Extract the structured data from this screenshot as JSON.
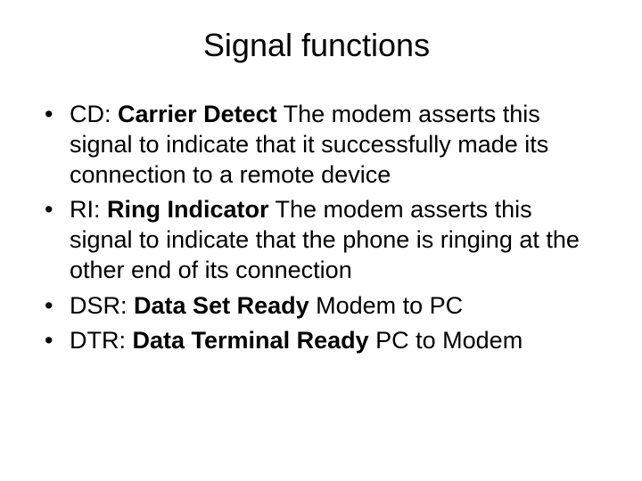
{
  "title": "Signal functions",
  "items": [
    {
      "acronym": "CD",
      "term": "Carrier Detect",
      "desc": " The modem asserts this signal to indicate that it successfully made its connection to a remote device"
    },
    {
      "acronym": "RI",
      "term": "Ring Indicator",
      "desc": " The modem asserts this signal to indicate that the phone is ringing at the other end of its connection"
    },
    {
      "acronym": "DSR",
      "term": "Data Set Ready",
      "desc": "  Modem to PC"
    },
    {
      "acronym": "DTR",
      "term": "Data Terminal Ready",
      "desc": " PC to Modem"
    }
  ]
}
